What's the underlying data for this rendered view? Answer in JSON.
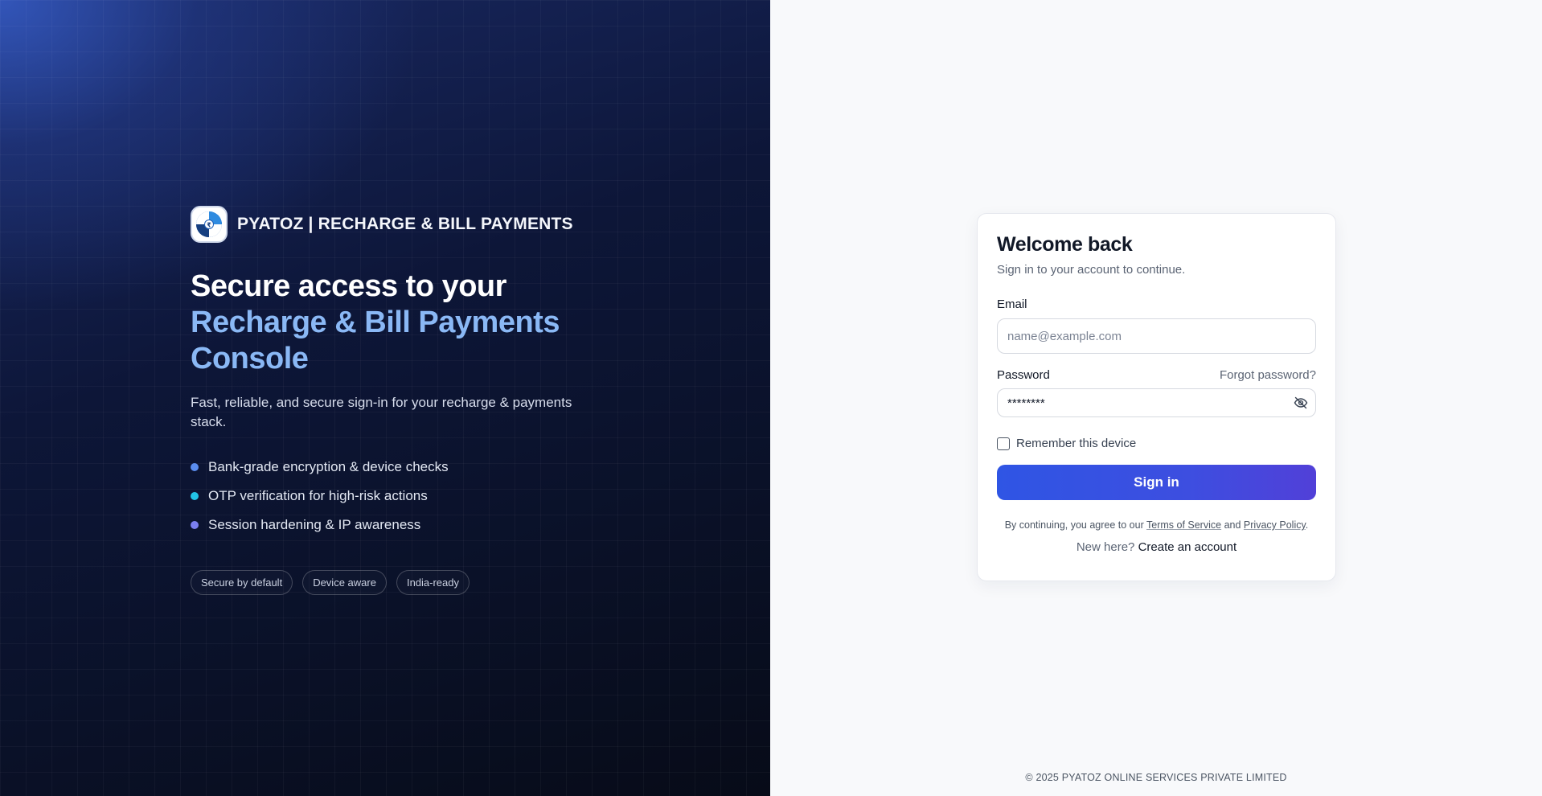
{
  "brand": {
    "name": "PYATOZ | RECHARGE & BILL PAYMENTS",
    "logo_icon": "pyatoz-logo-icon"
  },
  "hero": {
    "headline_line1": "Secure access to your",
    "headline_line2": "Recharge & Bill Payments Console",
    "description": "Fast, reliable, and secure sign-in for your recharge & payments stack.",
    "features": [
      {
        "text": "Bank-grade encryption & device checks",
        "dot_color": "#5b8def"
      },
      {
        "text": "OTP verification for high-risk actions",
        "dot_color": "#22c3e6"
      },
      {
        "text": "Session hardening & IP awareness",
        "dot_color": "#7b7ff0"
      }
    ],
    "chips": [
      "Secure by default",
      "Device aware",
      "India-ready"
    ]
  },
  "login": {
    "title": "Welcome back",
    "subtitle": "Sign in to your account to continue.",
    "email_label": "Email",
    "email_placeholder": "name@example.com",
    "email_value": "",
    "password_label": "Password",
    "forgot_label": "Forgot password?",
    "password_value": "********",
    "password_toggle_icon": "eye-off-icon",
    "remember_label": "Remember this device",
    "remember_checked": false,
    "signin_label": "Sign in",
    "terms_prefix": "By continuing, you agree to our",
    "terms_link": "Terms of Service",
    "terms_and": "and",
    "privacy_link": "Privacy Policy",
    "terms_suffix": ".",
    "new_here": "New here?",
    "create_account": "Create an account"
  },
  "footer": {
    "copyright": "© 2025 PYATOZ ONLINE SERVICES PRIVATE LIMITED"
  },
  "colors": {
    "accent": "#2f55e4",
    "headline_accent": "#8ab8f5"
  }
}
